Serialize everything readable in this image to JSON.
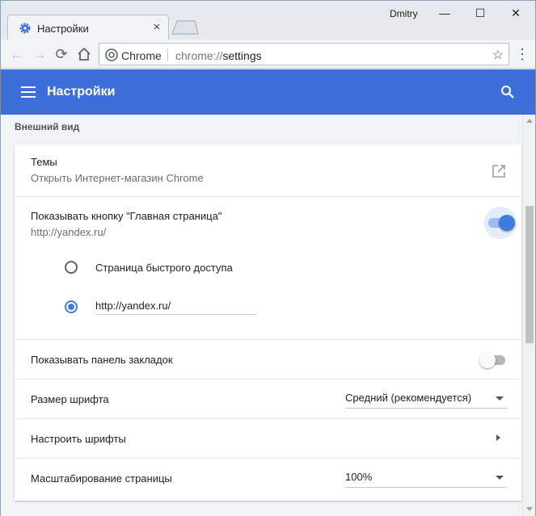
{
  "window": {
    "tab_title": "Настройки",
    "user_name": "Dmitry",
    "minimize_symbol": "—",
    "maximize_symbol": "☐",
    "close_symbol": "✕",
    "tab_close_symbol": "×"
  },
  "toolbar": {
    "back_symbol": "←",
    "forward_symbol": "→",
    "reload_symbol": "⟳",
    "home_icon": "home-icon",
    "chip_label": "Chrome",
    "url_prefix": "chrome://",
    "url_path": "settings",
    "star_symbol": "☆",
    "menu_symbol": "⋮"
  },
  "header": {
    "title": "Настройки"
  },
  "appearance": {
    "section_title": "Внешний вид",
    "themes": {
      "label": "Темы",
      "sublabel": "Открыть Интернет-магазин Chrome"
    },
    "home_button": {
      "label": "Показывать кнопку \"Главная страница\"",
      "sublabel": "http://yandex.ru/",
      "enabled": true,
      "options": [
        {
          "label": "Страница быстрого доступа",
          "checked": false
        },
        {
          "label": "",
          "checked": true,
          "value": "http://yandex.ru/"
        }
      ]
    },
    "bookmarks_bar": {
      "label": "Показывать панель закладок",
      "enabled": false
    },
    "font_size": {
      "label": "Размер шрифта",
      "value": "Средний (рекомендуется)"
    },
    "customize_fonts": {
      "label": "Настроить шрифты"
    },
    "page_zoom": {
      "label": "Масштабирование страницы",
      "value": "100%"
    }
  },
  "colors": {
    "accent": "#3e6fd8",
    "toggle_on": "#3e7ddc"
  }
}
